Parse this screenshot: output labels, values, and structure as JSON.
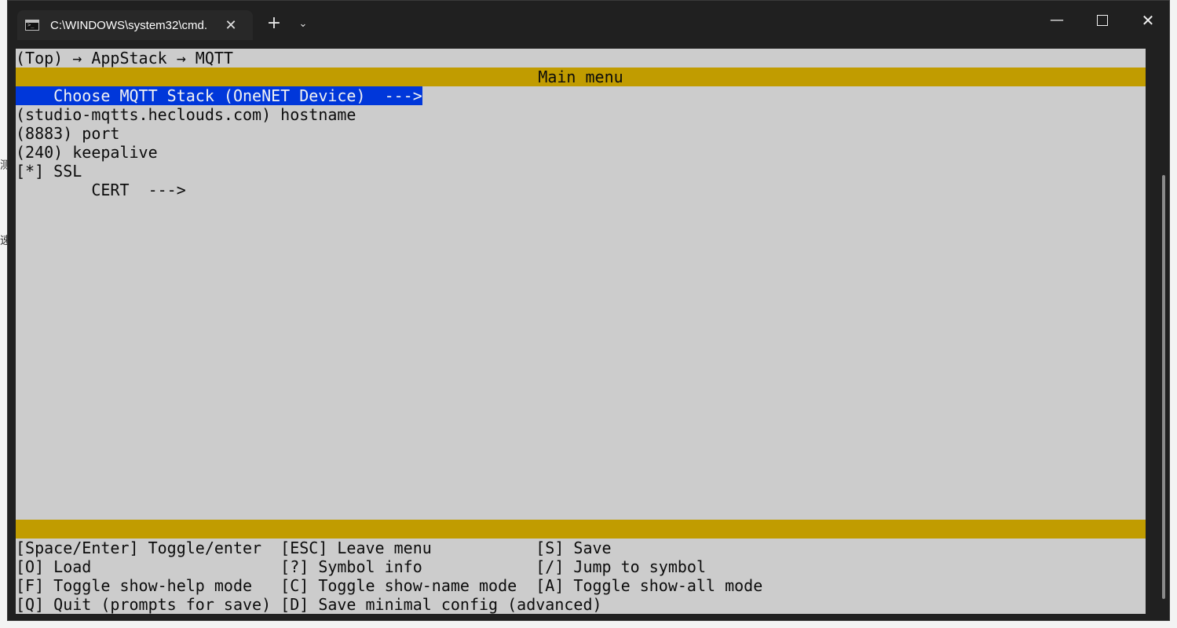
{
  "window": {
    "tab_title": "C:\\WINDOWS\\system32\\cmd.",
    "tab_close": "✕",
    "new_tab": "+",
    "tab_dropdown": "⌄",
    "minimize": "—",
    "close": "✕"
  },
  "terminal": {
    "breadcrumb": "(Top) → AppStack → MQTT",
    "menu_title": "Main menu",
    "items": [
      "    Choose MQTT Stack (OneNET Device)  --->",
      "(studio-mqtts.heclouds.com) hostname",
      "(8883) port",
      "(240) keepalive",
      "[*] SSL",
      "        CERT  --->"
    ],
    "help": [
      "[Space/Enter] Toggle/enter  [ESC] Leave menu           [S] Save",
      "[O] Load                    [?] Symbol info            [/] Jump to symbol",
      "[F] Toggle show-help mode   [C] Toggle show-name mode  [A] Toggle show-all mode",
      "[Q] Quit (prompts for save) [D] Save minimal config (advanced)"
    ]
  },
  "background": {
    "glyph1": "测",
    "glyph2": "速"
  },
  "colors": {
    "terminal_bg": "#cccccc",
    "title_bar": "#c19c00",
    "selection": "#0037da",
    "window_chrome": "#202020"
  }
}
